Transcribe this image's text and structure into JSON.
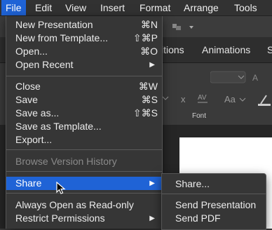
{
  "menubar": {
    "items": [
      "File",
      "Edit",
      "View",
      "Insert",
      "Format",
      "Arrange",
      "Tools"
    ],
    "active": "File"
  },
  "ribbon": {
    "tabs_partial": [
      "itions",
      "Animations",
      "S"
    ],
    "font_group_label": "Font",
    "controls": [
      "Aa",
      "AV"
    ]
  },
  "file_menu": {
    "groups": [
      [
        {
          "label": "New Presentation",
          "shortcut": "⌘N"
        },
        {
          "label": "New from Template...",
          "shortcut": "⇧⌘P"
        },
        {
          "label": "Open...",
          "shortcut": "⌘O"
        },
        {
          "label": "Open Recent",
          "submenu": true
        }
      ],
      [
        {
          "label": "Close",
          "shortcut": "⌘W"
        },
        {
          "label": "Save",
          "shortcut": "⌘S"
        },
        {
          "label": "Save as...",
          "shortcut": "⇧⌘S"
        },
        {
          "label": "Save as Template..."
        },
        {
          "label": "Export..."
        }
      ],
      [
        {
          "label": "Browse Version History",
          "disabled": true
        }
      ],
      [
        {
          "label": "Share",
          "submenu": true,
          "highlighted": true
        }
      ],
      [
        {
          "label": "Always Open as Read-only"
        },
        {
          "label": "Restrict Permissions",
          "submenu": true
        }
      ]
    ]
  },
  "share_submenu": {
    "items": [
      "Share...",
      "Send Presentation",
      "Send PDF"
    ]
  },
  "colors": {
    "highlight": "#1f63d6",
    "menu_bg": "#363636",
    "menubar_bg": "#323232"
  }
}
